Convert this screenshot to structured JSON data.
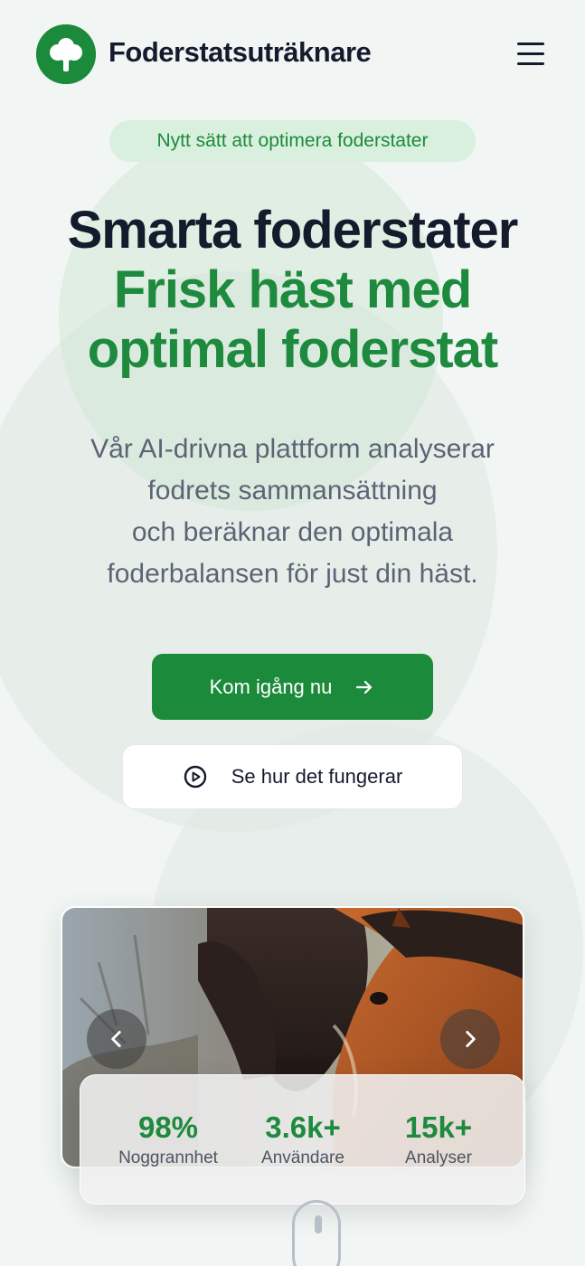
{
  "header": {
    "brand": "Foderstatsuträknare"
  },
  "hero": {
    "badge": "Nytt sätt att optimera foderstater",
    "title_line1": "Smarta foderstater",
    "title_line2": "Frisk häst med",
    "title_line3": "optimal foderstat",
    "subtitle_lines": [
      "Vår AI-drivna plattform analyserar",
      "fodrets sammansättning",
      "och beräknar den optimala",
      "foderbalansen för just din häst."
    ],
    "primary_cta": "Kom igång nu",
    "secondary_cta": "Se hur det fungerar"
  },
  "stats": [
    {
      "value": "98%",
      "label": "Noggrannhet"
    },
    {
      "value": "3.6k+",
      "label": "Användare"
    },
    {
      "value": "15k+",
      "label": "Analyser"
    }
  ],
  "colors": {
    "brand_green": "#1b8b3b",
    "heading_dark": "#141b2c",
    "body_gray": "#5b6474",
    "badge_bg": "#d9f0de"
  },
  "icons": {
    "logo": "tree-icon",
    "menu": "hamburger-menu-icon",
    "primary_cta": "arrow-right-icon",
    "secondary_cta": "play-circle-icon",
    "carousel_prev": "chevron-left-icon",
    "carousel_next": "chevron-right-icon",
    "scroll": "mouse-scroll-icon"
  }
}
